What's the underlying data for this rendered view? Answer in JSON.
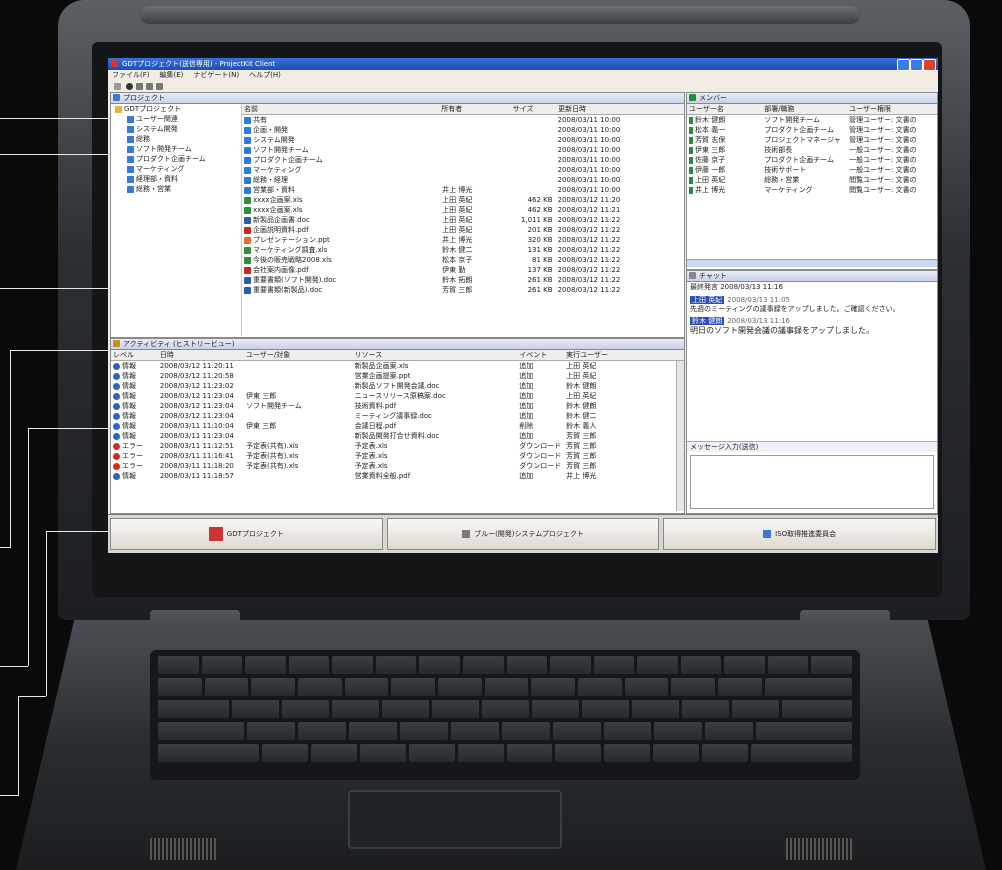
{
  "app": {
    "title": "GDTプロジェクト(送信専用) - ProjectKit Client",
    "menu": [
      "ファイル(F)",
      "編集(E)",
      "ナビゲート(N)",
      "ヘルプ(H)"
    ]
  },
  "project_pane": {
    "tab": "プロジェクト",
    "tree": [
      {
        "label": "GDTプロジェクト",
        "level": 0
      },
      {
        "label": "ユーザー関連",
        "level": 1
      },
      {
        "label": "システム開発",
        "level": 1
      },
      {
        "label": "総務",
        "level": 1
      },
      {
        "label": "ソフト開発チーム",
        "level": 1
      },
      {
        "label": "プロダクト企画チーム",
        "level": 1
      },
      {
        "label": "マーケティング",
        "level": 1
      },
      {
        "label": "経理部・資料",
        "level": 1
      },
      {
        "label": "総務・営業",
        "level": 1
      }
    ],
    "columns": [
      "名前",
      "所有者",
      "サイズ",
      "更新日時"
    ],
    "files": [
      {
        "name": "共有",
        "owner": "",
        "size": "",
        "date": "2008/03/11 10:00",
        "color": "#2a7de1"
      },
      {
        "name": "企画・開発",
        "owner": "",
        "size": "",
        "date": "2008/03/11 10:00",
        "color": "#2a7de1"
      },
      {
        "name": "システム開発",
        "owner": "",
        "size": "",
        "date": "2008/03/11 10:00",
        "color": "#2a7de1"
      },
      {
        "name": "ソフト開発チーム",
        "owner": "",
        "size": "",
        "date": "2008/03/11 10:00",
        "color": "#2a7de1"
      },
      {
        "name": "プロダクト企画チーム",
        "owner": "",
        "size": "",
        "date": "2008/03/11 10:00",
        "color": "#2a7de1"
      },
      {
        "name": "マーケティング",
        "owner": "",
        "size": "",
        "date": "2008/03/11 10:00",
        "color": "#2a7de1"
      },
      {
        "name": "総務・経理",
        "owner": "",
        "size": "",
        "date": "2008/03/11 10:00",
        "color": "#2a7de1"
      },
      {
        "name": "営業部・資料",
        "owner": "井上 博光",
        "size": "",
        "date": "2008/03/11 10:00",
        "color": "#2a7de1"
      },
      {
        "name": "xxxx企画案.xls",
        "owner": "上田 英紀",
        "size": "462 KB",
        "date": "2008/03/12 11:20",
        "color": "#2f8f3a"
      },
      {
        "name": "xxxx企画案.xls",
        "owner": "上田 英紀",
        "size": "462 KB",
        "date": "2008/03/12 11:21",
        "color": "#2f8f3a"
      },
      {
        "name": "新製品企画書.doc",
        "owner": "上田 英紀",
        "size": "1,011 KB",
        "date": "2008/03/12 11:22",
        "color": "#2a5db0"
      },
      {
        "name": "企画説明資料.pdf",
        "owner": "上田 英紀",
        "size": "201 KB",
        "date": "2008/03/12 11:22",
        "color": "#c8281e"
      },
      {
        "name": "プレゼンテーション.ppt",
        "owner": "井上 博光",
        "size": "320 KB",
        "date": "2008/03/12 11:22",
        "color": "#d9762a"
      },
      {
        "name": "マーケティング調査.xls",
        "owner": "鈴木 健二",
        "size": "131 KB",
        "date": "2008/03/12 11:22",
        "color": "#2f8f3a"
      },
      {
        "name": "今後の販売戦略2008.xls",
        "owner": "松本 京子",
        "size": "81 KB",
        "date": "2008/03/12 11:22",
        "color": "#2f8f3a"
      },
      {
        "name": "会社案内画像.pdf",
        "owner": "伊東   勤",
        "size": "137 KB",
        "date": "2008/03/12 11:22",
        "color": "#c8281e"
      },
      {
        "name": "重要書類(ソフト開発).doc",
        "owner": "鈴木 拓朗",
        "size": "261 KB",
        "date": "2008/03/12 11:22",
        "color": "#2a5db0"
      },
      {
        "name": "重要書類(新製品).doc",
        "owner": "芳賀 三郎",
        "size": "261 KB",
        "date": "2008/03/12 11:22",
        "color": "#2a5db0"
      }
    ]
  },
  "member_pane": {
    "tab": "メンバー",
    "columns": [
      "ユーザー名",
      "部署/職務",
      "ユーザー権限"
    ],
    "members": [
      {
        "name": "鈴木 健朗",
        "dept": "ソフト開発チーム",
        "role": "管理ユーザー: 文書の"
      },
      {
        "name": "松本 義一",
        "dept": "プロダクト企画チーム",
        "role": "管理ユーザー: 文書の"
      },
      {
        "name": "芳賀 志保",
        "dept": "プロジェクトマネージャ",
        "role": "管理ユーザー: 文書の"
      },
      {
        "name": "伊東 三郎",
        "dept": "技術部長",
        "role": "一般ユーザー: 文書の"
      },
      {
        "name": "佐藤 京子",
        "dept": "プロダクト企画チーム",
        "role": "一般ユーザー: 文書の"
      },
      {
        "name": "伊藤 一郎",
        "dept": "技術サポート",
        "role": "一般ユーザー: 文書の"
      },
      {
        "name": "上田 英紀",
        "dept": "総務・営業",
        "role": "閲覧ユーザー: 文書の"
      },
      {
        "name": "井上 博光",
        "dept": "マーケティング",
        "role": "閲覧ユーザー: 文書の"
      }
    ]
  },
  "chat_pane": {
    "tab": "チャット",
    "header": "最終発言 2008/03/13 11:16",
    "messages": [
      {
        "name": "上田 英紀",
        "time": "2008/03/13 11:05",
        "text": "先週のミーティングの議事録をアップしました。ご確認ください。"
      },
      {
        "name": "鈴木 健朗",
        "time": "2008/03/13 11:16",
        "text": "明日のソフト開発会議の議事録をアップしました。"
      }
    ],
    "input_label": "メッセージ入力(送信)"
  },
  "activity_pane": {
    "tab": "アクティビティ (ヒストリービュー)",
    "columns": [
      "レベル",
      "日時",
      "ユーザー/対象",
      "リソース",
      "イベント",
      "実行ユーザー"
    ],
    "rows": [
      {
        "level": "情報",
        "date": "2008/03/12 11:20:11",
        "target": "",
        "resource": "新製品企画案.xls",
        "event": "追加",
        "user": "上田 英紀",
        "type": "info"
      },
      {
        "level": "情報",
        "date": "2008/03/12 11:20:58",
        "target": "",
        "resource": "営業企画提案.ppt",
        "event": "追加",
        "user": "上田 英紀",
        "type": "info"
      },
      {
        "level": "情報",
        "date": "2008/03/12 11:23:02",
        "target": "",
        "resource": "新製品ソフト開発会議.doc",
        "event": "追加",
        "user": "鈴木 健朗",
        "type": "info"
      },
      {
        "level": "情報",
        "date": "2008/03/12 11:23:04",
        "target": "伊東 三郎",
        "resource": "ニュースリリース原稿案.doc",
        "event": "追加",
        "user": "上田 英紀",
        "type": "info"
      },
      {
        "level": "情報",
        "date": "2008/03/12 11:23:04",
        "target": "ソフト開発チーム",
        "resource": "技術資料.pdf",
        "event": "追加",
        "user": "鈴木 健朗",
        "type": "info"
      },
      {
        "level": "情報",
        "date": "2008/03/12 11:23:04",
        "target": "",
        "resource": "ミーティング議事録.doc",
        "event": "追加",
        "user": "鈴木 健二",
        "type": "info"
      },
      {
        "level": "情報",
        "date": "2008/03/11 11:10:04",
        "target": "伊東 三郎",
        "resource": "会議日程.pdf",
        "event": "削除",
        "user": "鈴木 義人",
        "type": "info"
      },
      {
        "level": "情報",
        "date": "2008/03/11 11:23:04",
        "target": "",
        "resource": "新製品開発打合せ資料.doc",
        "event": "追加",
        "user": "芳賀 三郎",
        "type": "info"
      },
      {
        "level": "エラー",
        "date": "2008/03/11 11:12:51",
        "target": "予定表(共有).xls",
        "resource": "予定表.xls",
        "event": "ダウンロード",
        "user": "芳賀 三郎",
        "type": "error"
      },
      {
        "level": "エラー",
        "date": "2008/03/11 11:16:41",
        "target": "予定表(共有).xls",
        "resource": "予定表.xls",
        "event": "ダウンロード",
        "user": "芳賀 三郎",
        "type": "error"
      },
      {
        "level": "エラー",
        "date": "2008/03/11 11:18:20",
        "target": "予定表(共有).xls",
        "resource": "予定表.xls",
        "event": "ダウンロード",
        "user": "芳賀 三郎",
        "type": "error"
      },
      {
        "level": "情報",
        "date": "2008/03/11 11:18:57",
        "target": "",
        "resource": "営業資料全般.pdf",
        "event": "追加",
        "user": "井上 博光",
        "type": "info"
      }
    ]
  },
  "taskbar": {
    "buttons": [
      {
        "label": "GDTプロジェクト"
      },
      {
        "label": "ブルー(開発)システムプロジェクト"
      },
      {
        "label": "ISO取得推進委員会"
      }
    ]
  }
}
